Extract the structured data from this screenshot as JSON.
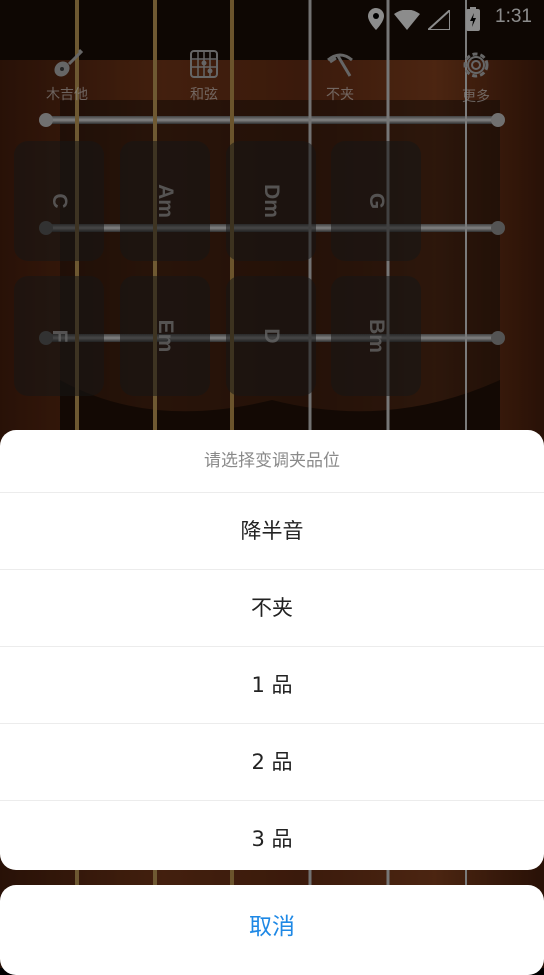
{
  "status_bar": {
    "time": "1:31"
  },
  "toolbar": {
    "items": [
      {
        "label": "木吉他",
        "icon": "guitar-icon"
      },
      {
        "label": "和弦",
        "icon": "chord-grid-icon"
      },
      {
        "label": "不夹",
        "icon": "capo-icon"
      },
      {
        "label": "更多",
        "icon": "gear-icon"
      }
    ]
  },
  "chords": [
    "C",
    "Am",
    "Dm",
    "G",
    "F",
    "Em",
    "D",
    "Bm"
  ],
  "sheet": {
    "title": "请选择变调夹品位",
    "options": [
      "降半音",
      "不夹",
      "1 品",
      "2 品",
      "3 品"
    ],
    "cancel": "取消"
  },
  "colors": {
    "accent": "#1e88e5",
    "wood": "#6b3218",
    "sheet_bg": "#ffffff"
  }
}
